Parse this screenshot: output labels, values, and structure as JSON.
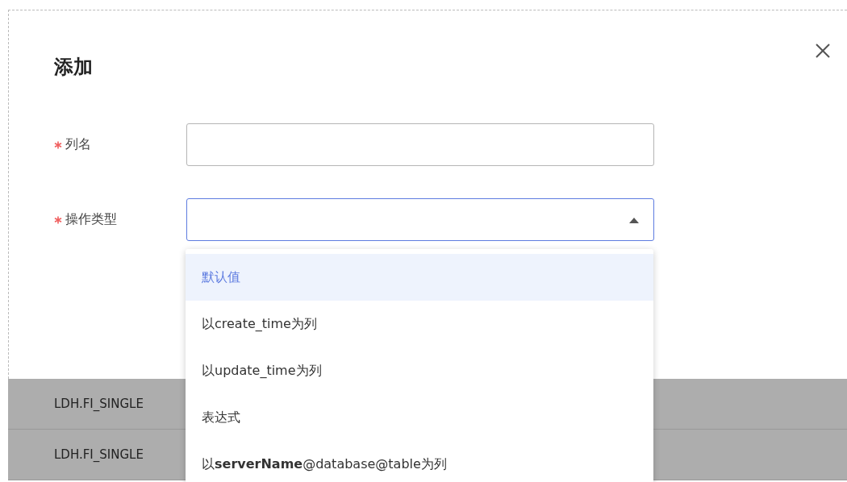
{
  "dialog": {
    "title": "添加",
    "fields": [
      {
        "label": "列名",
        "required": true,
        "kind": "input",
        "focused": false
      },
      {
        "label": "操作类型",
        "required": true,
        "kind": "select",
        "focused": true,
        "expanded": true
      }
    ]
  },
  "dropdown": {
    "options": [
      {
        "label": "默认值",
        "selected": true
      },
      {
        "label": "以create_time为列",
        "selected": false
      },
      {
        "label": "以update_time为列",
        "selected": false
      },
      {
        "label": "表达式",
        "selected": false
      },
      {
        "label": "以**serverName**@database@table为列",
        "selected": false
      }
    ]
  },
  "table": {
    "rows": [
      {
        "column_1": "LDH.FI_SINGLE"
      },
      {
        "column_1": "LDH.FI_SINGLE"
      }
    ]
  }
}
